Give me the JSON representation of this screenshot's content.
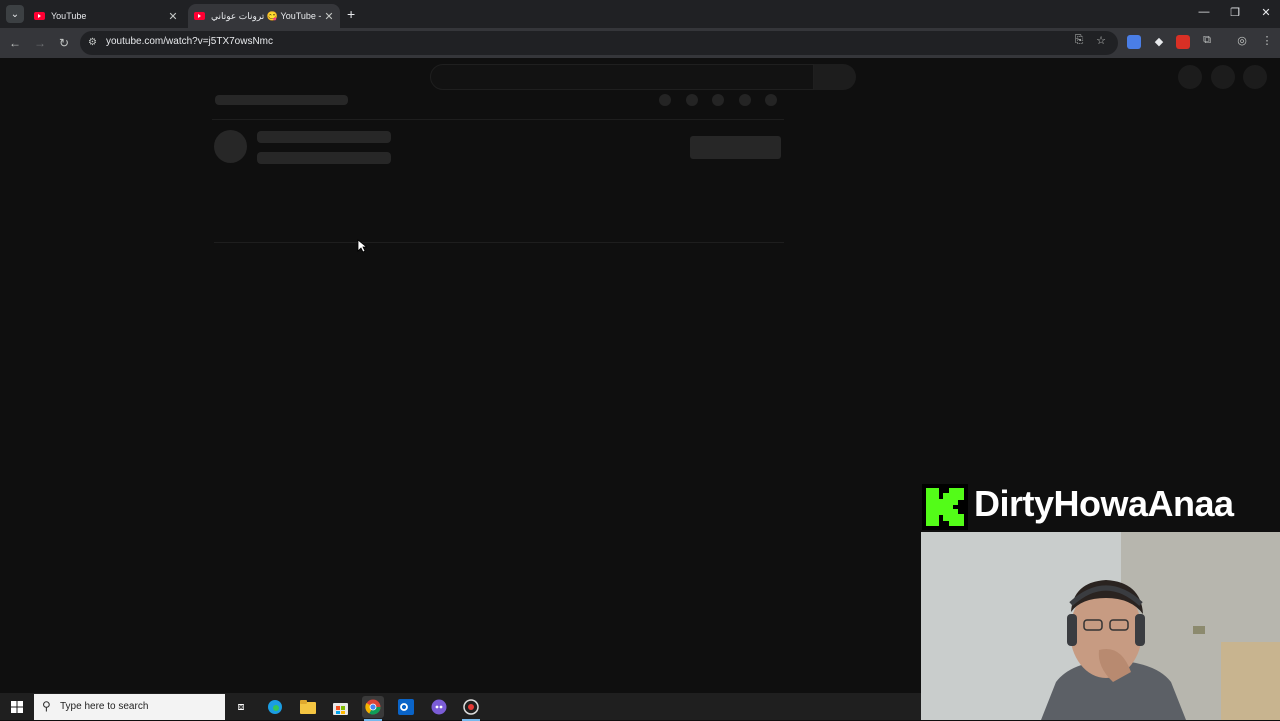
{
  "browser": {
    "tabs": [
      {
        "title": "YouTube",
        "active": false
      },
      {
        "title": "ترونات عوتاني 😋 YouTube - A:",
        "active": true
      }
    ],
    "url": "youtube.com/watch?v=j5TX7owsNmc"
  },
  "overlay": {
    "brand_name": "DirtyHowaAnaa",
    "logo_letter": "K",
    "logo_color": "#53fc18"
  },
  "taskbar": {
    "search_placeholder": "Type here to search"
  },
  "colors": {
    "page_bg": "#0f0f0f",
    "tabstrip_bg": "#202124",
    "toolbar_bg": "#35363a",
    "youtube_red": "#ff0033"
  }
}
